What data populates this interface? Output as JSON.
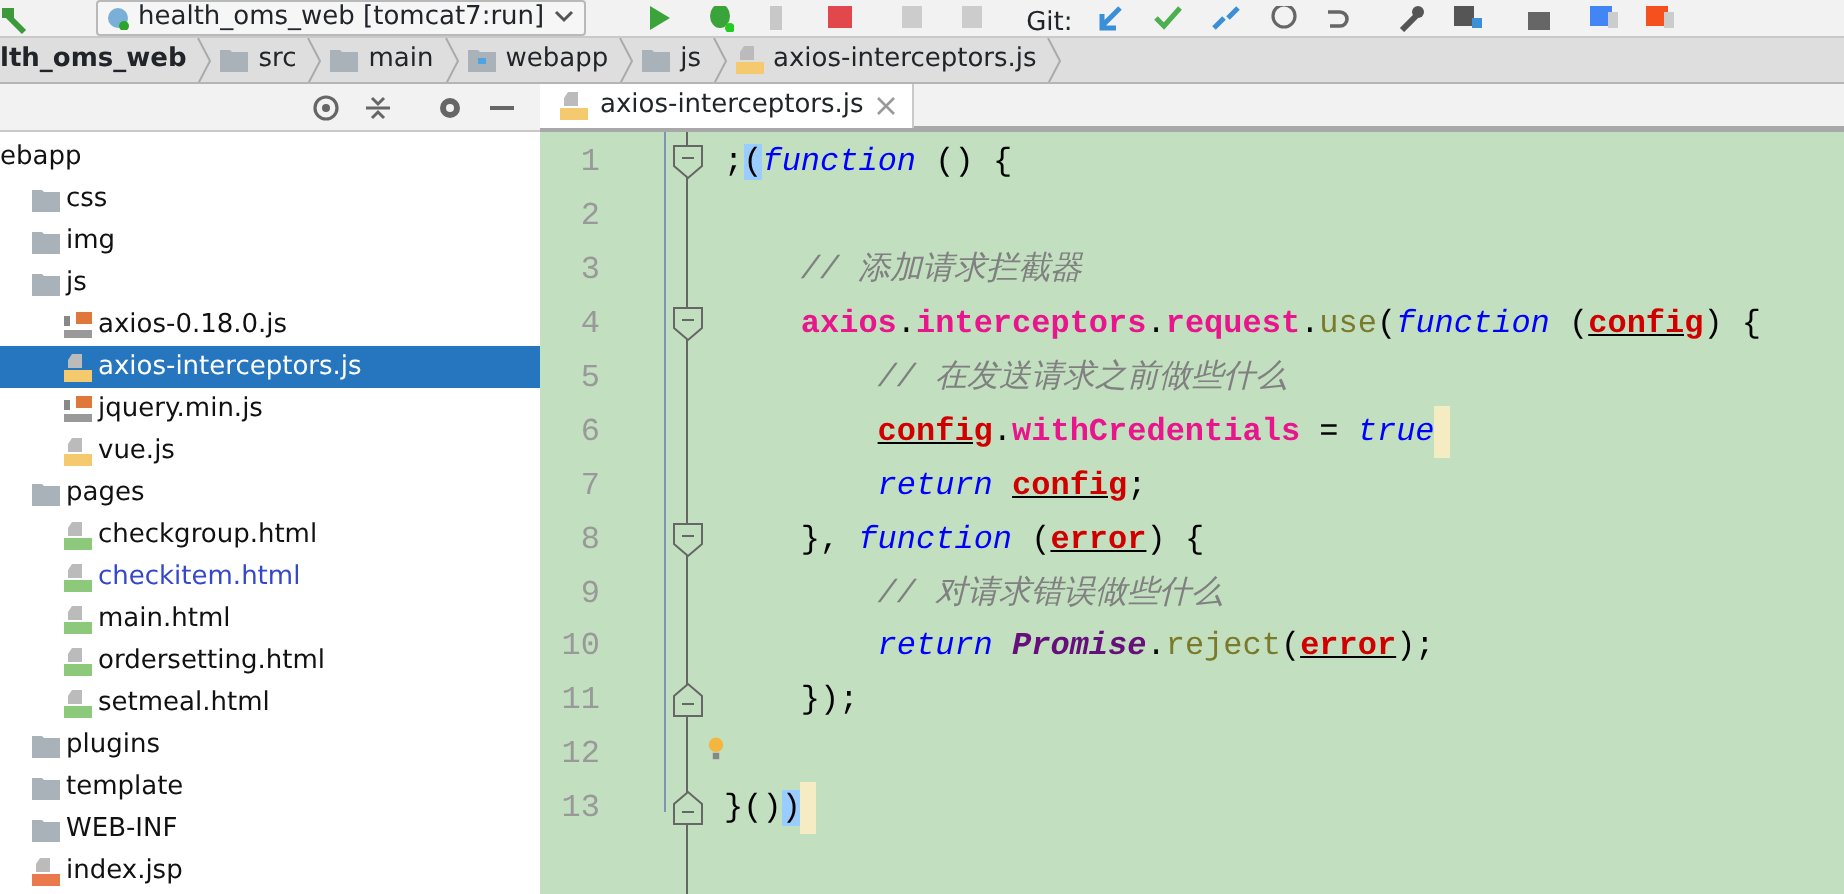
{
  "toolbar": {
    "run_config": "health_oms_web [tomcat7:run]",
    "git_label": "Git:"
  },
  "breadcrumb": [
    {
      "label": "lth_oms_web",
      "kind": "module"
    },
    {
      "label": "src",
      "kind": "folder"
    },
    {
      "label": "main",
      "kind": "folder"
    },
    {
      "label": "webapp",
      "kind": "web-folder"
    },
    {
      "label": "js",
      "kind": "folder"
    },
    {
      "label": "axios-interceptors.js",
      "kind": "js"
    }
  ],
  "project_tree": [
    {
      "label": "ebapp",
      "selected": false,
      "modified": false,
      "children": [
        {
          "label": "css",
          "kind": "folder",
          "selected": false,
          "modified": false
        },
        {
          "label": "img",
          "kind": "folder",
          "selected": false,
          "modified": false
        },
        {
          "label": "js",
          "kind": "folder",
          "selected": false,
          "modified": false,
          "children": [
            {
              "label": "axios-0.18.0.js",
              "kind": "js-lib",
              "selected": false,
              "modified": false
            },
            {
              "label": "axios-interceptors.js",
              "kind": "js",
              "selected": true,
              "modified": false
            },
            {
              "label": "jquery.min.js",
              "kind": "js-lib",
              "selected": false,
              "modified": false
            },
            {
              "label": "vue.js",
              "kind": "js",
              "selected": false,
              "modified": false
            }
          ]
        },
        {
          "label": "pages",
          "kind": "folder",
          "selected": false,
          "modified": false,
          "children": [
            {
              "label": "checkgroup.html",
              "kind": "html",
              "selected": false,
              "modified": false
            },
            {
              "label": "checkitem.html",
              "kind": "html",
              "selected": false,
              "modified": true
            },
            {
              "label": "main.html",
              "kind": "html",
              "selected": false,
              "modified": false
            },
            {
              "label": "ordersetting.html",
              "kind": "html",
              "selected": false,
              "modified": false
            },
            {
              "label": "setmeal.html",
              "kind": "html",
              "selected": false,
              "modified": false
            }
          ]
        },
        {
          "label": "plugins",
          "kind": "folder",
          "selected": false,
          "modified": false
        },
        {
          "label": "template",
          "kind": "folder",
          "selected": false,
          "modified": false
        },
        {
          "label": "WEB-INF",
          "kind": "folder",
          "selected": false,
          "modified": false
        },
        {
          "label": "index.jsp",
          "kind": "jsp",
          "selected": false,
          "modified": false
        }
      ]
    }
  ],
  "editor_tabs": [
    {
      "label": "axios-interceptors.js",
      "selected": true
    }
  ],
  "code_lines": [
    {
      "number": "1",
      "kind": "fold-start",
      "tokens": [
        {
          "text": ";",
          "kind": "plain"
        },
        {
          "text": "(",
          "kind": "plain",
          "match": true
        },
        {
          "text": "function",
          "kind": "keyword"
        },
        {
          "text": " () {",
          "kind": "plain"
        }
      ],
      "children": [
        {
          "number": "2",
          "kind": "plain"
        },
        {
          "number": "3",
          "kind": "plain",
          "tokens": [
            {
              "text": "// 添加请求拦截器",
              "kind": "comment"
            }
          ]
        },
        {
          "number": "4",
          "kind": "fold-start",
          "tokens": [
            {
              "text": "axios",
              "kind": "field"
            },
            {
              "text": ".",
              "kind": "plain"
            },
            {
              "text": "interceptors",
              "kind": "field"
            },
            {
              "text": ".",
              "kind": "plain"
            },
            {
              "text": "request",
              "kind": "field"
            },
            {
              "text": ".",
              "kind": "plain"
            },
            {
              "text": "use",
              "kind": "method"
            },
            {
              "text": "(",
              "kind": "plain"
            },
            {
              "text": "function",
              "kind": "keyword"
            },
            {
              "text": " (",
              "kind": "plain"
            },
            {
              "text": "config",
              "kind": "param"
            },
            {
              "text": ") {",
              "kind": "plain"
            }
          ],
          "children": [
            {
              "number": "5",
              "kind": "plain",
              "tokens": [
                {
                  "text": "// 在发送请求之前做些什么",
                  "kind": "comment"
                }
              ]
            },
            {
              "number": "6",
              "kind": "plain",
              "caret": true,
              "tokens": [
                {
                  "text": "config",
                  "kind": "param"
                },
                {
                  "text": ".",
                  "kind": "plain"
                },
                {
                  "text": "withCredentials",
                  "kind": "field"
                },
                {
                  "text": " = ",
                  "kind": "plain"
                },
                {
                  "text": "true",
                  "kind": "keyword"
                }
              ]
            },
            {
              "number": "7",
              "kind": "plain",
              "tokens": [
                {
                  "text": "return ",
                  "kind": "keyword"
                },
                {
                  "text": "config",
                  "kind": "param"
                },
                {
                  "text": ";",
                  "kind": "plain"
                }
              ]
            }
          ]
        },
        {
          "number": "8",
          "kind": "fold-start",
          "tokens": [
            {
              "text": "}, ",
              "kind": "plain"
            },
            {
              "text": "function",
              "kind": "keyword"
            },
            {
              "text": " (",
              "kind": "plain"
            },
            {
              "text": "error",
              "kind": "param"
            },
            {
              "text": ") {",
              "kind": "plain"
            }
          ],
          "children": [
            {
              "number": "9",
              "kind": "plain",
              "tokens": [
                {
                  "text": "// 对请求错误做些什么",
                  "kind": "comment"
                }
              ]
            },
            {
              "number": "10",
              "kind": "plain",
              "tokens": [
                {
                  "text": "return ",
                  "kind": "keyword"
                },
                {
                  "text": "Promise",
                  "kind": "class"
                },
                {
                  "text": ".",
                  "kind": "plain"
                },
                {
                  "text": "reject",
                  "kind": "method"
                },
                {
                  "text": "(",
                  "kind": "plain"
                },
                {
                  "text": "error",
                  "kind": "param"
                },
                {
                  "text": ");",
                  "kind": "plain"
                }
              ]
            }
          ]
        },
        {
          "number": "11",
          "kind": "fold-end",
          "tokens": [
            {
              "text": "});",
              "kind": "plain"
            }
          ]
        },
        {
          "number": "12",
          "kind": "plain",
          "bulb": true
        }
      ]
    },
    {
      "number": "13",
      "kind": "fold-end",
      "caret": true,
      "tokens": [
        {
          "text": "}()",
          "kind": "plain"
        },
        {
          "text": ")",
          "kind": "plain",
          "match": true
        }
      ]
    }
  ]
}
